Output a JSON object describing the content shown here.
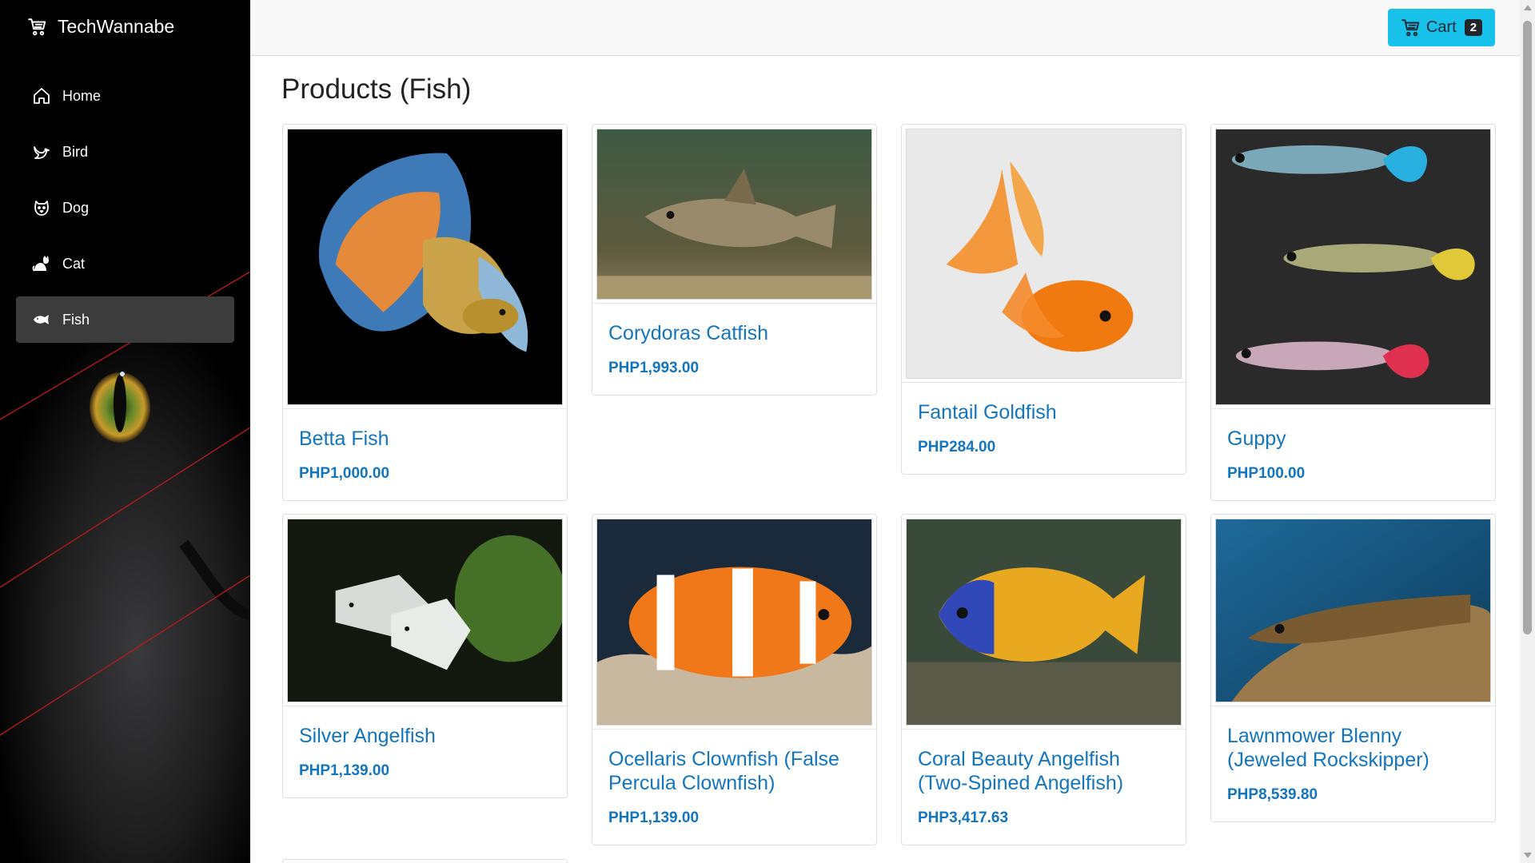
{
  "brand": {
    "name": "TechWannabe",
    "icon": "shopping-cart-icon"
  },
  "nav": [
    {
      "label": "Home",
      "icon": "home-icon",
      "active": false
    },
    {
      "label": "Bird",
      "icon": "bird-icon",
      "active": false
    },
    {
      "label": "Dog",
      "icon": "dog-icon",
      "active": false
    },
    {
      "label": "Cat",
      "icon": "cat-icon",
      "active": false
    },
    {
      "label": "Fish",
      "icon": "fish-icon",
      "active": true
    }
  ],
  "header": {
    "cart_label": "Cart",
    "cart_count": "2",
    "cart_icon": "shopping-cart-icon",
    "accent": "#17c1ea"
  },
  "page": {
    "title": "Products (Fish)"
  },
  "products": [
    {
      "name": "Betta Fish",
      "price": "PHP1,000.00",
      "image": "betta-fish-image"
    },
    {
      "name": "Corydoras Catfish",
      "price": "PHP1,993.00",
      "image": "corydoras-catfish-image"
    },
    {
      "name": "Fantail Goldfish",
      "price": "PHP284.00",
      "image": "fantail-goldfish-image"
    },
    {
      "name": "Guppy",
      "price": "PHP100.00",
      "image": "guppy-image"
    },
    {
      "name": "Silver Angelfish",
      "price": "PHP1,139.00",
      "image": "silver-angelfish-image"
    },
    {
      "name": "Ocellaris Clownfish (False Percula Clownfish)",
      "price": "PHP1,139.00",
      "image": "clownfish-image"
    },
    {
      "name": "Coral Beauty Angelfish (Two-Spined Angelfish)",
      "price": "PHP3,417.63",
      "image": "coral-beauty-angelfish-image"
    },
    {
      "name": "Lawnmower Blenny (Jeweled Rockskipper)",
      "price": "PHP8,539.80",
      "image": "lawnmower-blenny-image"
    }
  ]
}
